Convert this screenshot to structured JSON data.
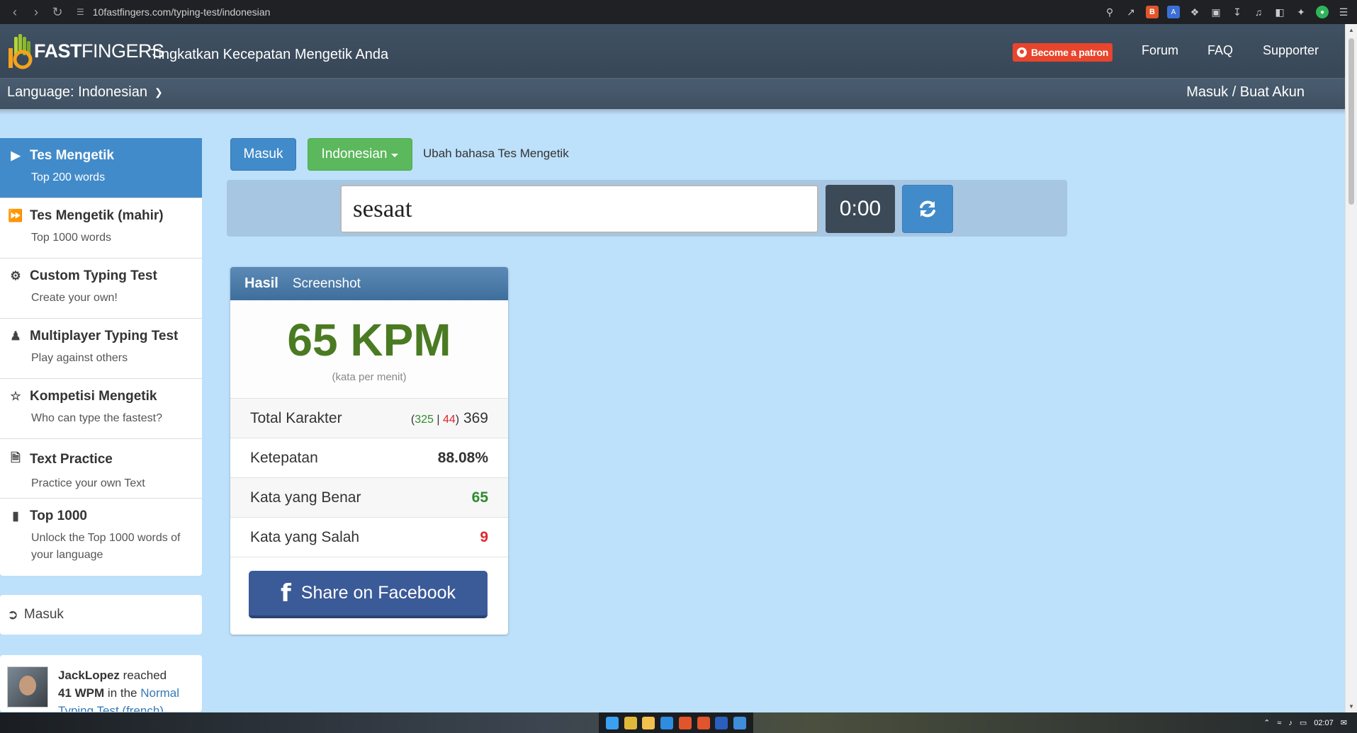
{
  "browser": {
    "url": "10fastfingers.com/typing-test/indonesian"
  },
  "header": {
    "logo_light": "10",
    "logo_bold": "FAST",
    "logo_rest": "FINGERS",
    "tagline": "Tingkatkan Kecepatan Mengetik Anda",
    "patron_label": "Become a patron",
    "nav": [
      "Forum",
      "FAQ",
      "Supporter"
    ],
    "language_label": "Language: Indonesian",
    "login_label": "Masuk / Buat Akun"
  },
  "sidebar": {
    "items": [
      {
        "title": "Tes Mengetik",
        "sub": "Top 200 words",
        "icon": "play-icon",
        "active": true
      },
      {
        "title": "Tes Mengetik (mahir)",
        "sub": "Top 1000 words",
        "icon": "fast-forward-icon"
      },
      {
        "title": "Custom Typing Test",
        "sub": "Create your own!",
        "icon": "gears-icon"
      },
      {
        "title": "Multiplayer Typing Test",
        "sub": "Play against others",
        "icon": "users-icon"
      },
      {
        "title": "Kompetisi Mengetik",
        "sub": "Who can type the fastest?",
        "icon": "trophy-icon"
      },
      {
        "title": "Text Practice",
        "sub": "Practice your own Text",
        "icon": "document-icon"
      },
      {
        "title": "Top 1000",
        "sub": "Unlock the Top 1000 words of your language",
        "icon": "signal-icon"
      }
    ],
    "login_label": "Masuk",
    "feed": {
      "user": "JackLopez",
      "reached": "reached",
      "wpm": "41 WPM",
      "in_the": "in the",
      "link": "Normal Typing Test (french)"
    }
  },
  "main": {
    "login_button": "Masuk",
    "language_button": "Indonesian",
    "change_language": "Ubah bahasa Tes Mengetik",
    "input_value": "sesaat",
    "timer": "0:00"
  },
  "result": {
    "tab_active": "Hasil",
    "tab_other": "Screenshot",
    "wpm": "65 KPM",
    "wpm_unit": "(kata per menit)",
    "rows": {
      "total_label": "Total Karakter",
      "total_correct": "325",
      "total_wrong": "44",
      "total_value": "369",
      "accuracy_label": "Ketepatan",
      "accuracy_value": "88.08%",
      "correct_label": "Kata yang Benar",
      "correct_value": "65",
      "wrong_label": "Kata yang Salah",
      "wrong_value": "9"
    },
    "facebook_label": "Share on Facebook"
  },
  "taskbar": {
    "time": "02:07"
  },
  "colors": {
    "page_bg": "#bde0fb",
    "header_bg": "#3f5163",
    "primary_blue": "#428bca",
    "green_button": "#5cb85c",
    "wpm_green": "#4a7a22",
    "facebook": "#3b5a98",
    "error_red": "#e0262f",
    "patron_orange": "#e8452c"
  }
}
